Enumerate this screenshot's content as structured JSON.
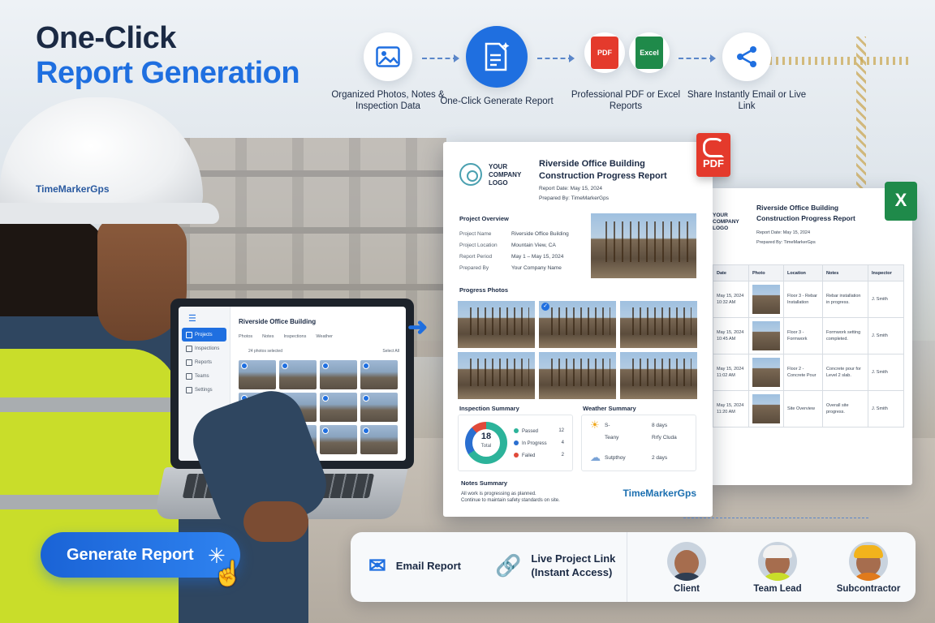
{
  "headline": {
    "line1": "One-Click",
    "line2": "Report Generation"
  },
  "workflow": {
    "step1": "Organized Photos, Notes & Inspection Data",
    "step2": "One-Click Generate Report",
    "step3": "Professional PDF or Excel Reports",
    "step4": "Share Instantly Email or Live Link",
    "pdf_badge": "PDF",
    "excel_badge": "Excel"
  },
  "helmet_brand": "TimeMarkerGps",
  "laptop": {
    "title": "Riverside Office Building",
    "nav": [
      "Projects",
      "Inspections",
      "Reports",
      "Teams",
      "Settings"
    ],
    "tabs": [
      "Photos",
      "Notes",
      "Inspections",
      "Weather"
    ],
    "photo_count": "24 photos selected",
    "select_all": "Select All"
  },
  "pdf_report": {
    "logo": "YOUR COMPANY LOGO",
    "title": "Riverside Office Building Construction Progress Report",
    "report_date": "Report Date: May 15, 2024",
    "prepared_by": "Prepared By: TimeMarkerGps",
    "overview_heading": "Project Overview",
    "overview": [
      {
        "k": "Project Name",
        "v": "Riverside Office Building"
      },
      {
        "k": "Project Location",
        "v": "Mountain View, CA"
      },
      {
        "k": "Report Period",
        "v": "May 1 – May 15, 2024"
      },
      {
        "k": "Prepared By",
        "v": "Your Company Name"
      }
    ],
    "photos_heading": "Progress Photos",
    "inspection_heading": "Inspection Summary",
    "inspection_total": "18",
    "inspection_total_label": "Total",
    "inspection": [
      {
        "label": "Passed",
        "count": "12",
        "color": "#2cb39a"
      },
      {
        "label": "In Progress",
        "count": "4",
        "color": "#2a6fd0"
      },
      {
        "label": "Failed",
        "count": "2",
        "color": "#e04a3a"
      }
    ],
    "weather_heading": "Weather Summary",
    "weather": [
      {
        "icon": "☀",
        "label": "S-",
        "days": "8 days"
      },
      {
        "icon": "",
        "label": "Teany",
        "days": "Rrfy Cluda"
      },
      {
        "icon": "☁",
        "label": "Sutpthoy",
        "days": "2 days"
      }
    ],
    "notes_heading": "Notes Summary",
    "notes_line1": "All work is progressing as planned.",
    "notes_line2": "Continue to maintain safety standards on site.",
    "brand": "TimeMarkerGps",
    "file_badge": "PDF"
  },
  "excel_report": {
    "logo": "YOUR COMPANY LOGO",
    "title_line1": "Riverside Office Building",
    "title_line2": "Construction Progress Report",
    "report_date": "Report Date: May 15, 2024",
    "prepared_by": "Prepared By: TimeMarkerGps",
    "file_badge": "X",
    "headers": [
      "Date",
      "Photo",
      "Location",
      "Notes",
      "Inspector"
    ],
    "rows": [
      {
        "date": "May 15, 2024 10:32 AM",
        "location": "Floor 3 - Rebar Installation",
        "notes": "Rebar installation in progress.",
        "inspector": "J. Smith"
      },
      {
        "date": "May 15, 2024 10:45 AM",
        "location": "Floor 3 - Formwork",
        "notes": "Formwork setting completed.",
        "inspector": "J. Smith"
      },
      {
        "date": "May 15, 2024 11:02 AM",
        "location": "Floor 2 - Concrete Pour",
        "notes": "Concrete pour for Level 2 slab.",
        "inspector": "J. Smith"
      },
      {
        "date": "May 15, 2024 11:20 AM",
        "location": "Site Overview",
        "notes": "Overall site progress.",
        "inspector": "J. Smith"
      }
    ]
  },
  "share": {
    "email": "Email Report",
    "live_link": "Live Project Link (Instant Access)",
    "recipients": [
      "Client",
      "Team Lead",
      "Subcontractor"
    ]
  },
  "generate_button": "Generate Report",
  "colors": {
    "accent": "#1f6fe0",
    "pdf": "#e43a2c",
    "excel": "#1f8a4a"
  }
}
